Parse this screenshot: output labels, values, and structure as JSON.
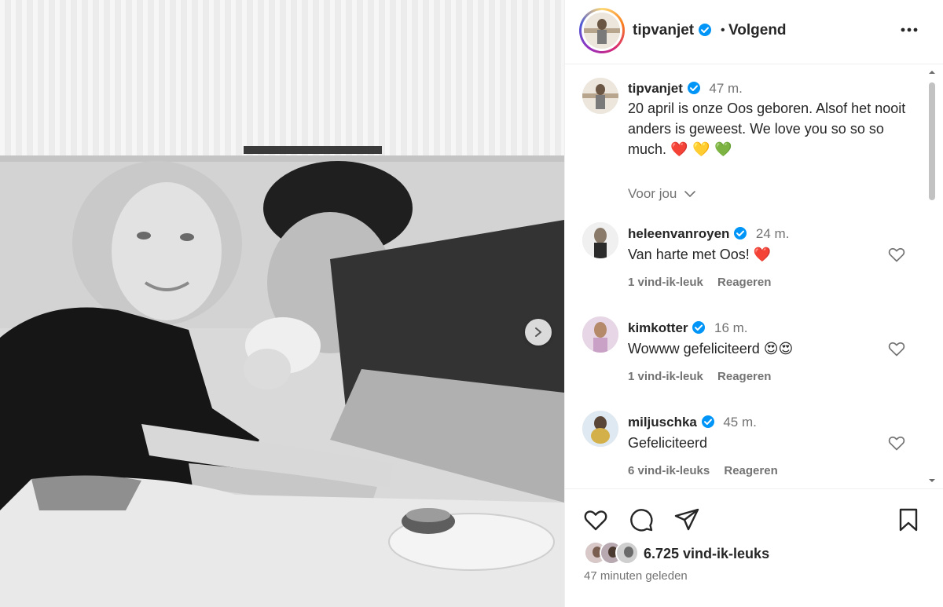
{
  "post": {
    "author": "tipvanjet",
    "follow_state": "Volgend",
    "separator": "•",
    "caption": {
      "user": "tipvanjet",
      "time": "47 m.",
      "text": "20 april is onze Oos geboren. Alsof het nooit anders is geweest. We love you so so so much.",
      "emojis": "❤️ 💛 💚"
    },
    "voor_jou_label": "Voor jou"
  },
  "comments": [
    {
      "user": "heleenvanroyen",
      "time": "24 m.",
      "text": "Van harte met Oos!",
      "emoji": "❤️",
      "likes": "1 vind-ik-leuk",
      "reply": "Reageren"
    },
    {
      "user": "kimkotter",
      "time": "16 m.",
      "text": "Wowww gefeliciteerd",
      "emoji": "😍😍",
      "likes": "1 vind-ik-leuk",
      "reply": "Reageren"
    },
    {
      "user": "miljuschka",
      "time": "45 m.",
      "text": "Gefeliciteerd",
      "emoji": "",
      "likes": "6 vind-ik-leuks",
      "reply": "Reageren"
    }
  ],
  "footer": {
    "likes_total": "6.725 vind-ik-leuks",
    "posted": "47 minuten geleden"
  },
  "icons": {
    "verified": "verified-badge-icon",
    "more": "more-options-icon",
    "like": "heart-icon",
    "comment": "comment-icon",
    "share": "paper-plane-icon",
    "save": "bookmark-icon",
    "next": "chevron-right-icon"
  },
  "colors": {
    "verified_blue": "#0095f6",
    "text_primary": "#262626",
    "text_secondary": "#737373",
    "heart_red": "#e53935"
  }
}
